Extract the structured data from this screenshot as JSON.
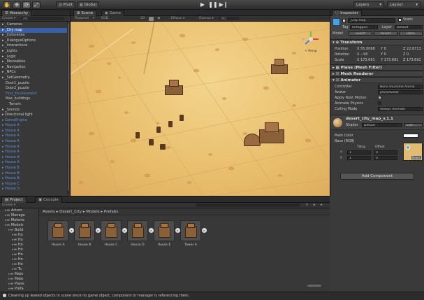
{
  "toolbar": {
    "pivot": "Pivot",
    "global": "Global",
    "layers": "Layers",
    "layout": "Layout"
  },
  "hierarchy": {
    "tab": "Hierarchy",
    "create": "Create ▾",
    "search": "(All",
    "items": [
      {
        "label": "_Cameras",
        "color": "white"
      },
      {
        "label": "_City map",
        "color": "white",
        "selected": true
      },
      {
        "label": "_Cutscenes",
        "color": "white"
      },
      {
        "label": "_DialogueOptions",
        "color": "white"
      },
      {
        "label": "_Interactions",
        "color": "white"
      },
      {
        "label": "_Lights",
        "color": "white"
      },
      {
        "label": "_Logic",
        "color": "white"
      },
      {
        "label": "_Moveables",
        "color": "white"
      },
      {
        "label": "_Navigation",
        "color": "white"
      },
      {
        "label": "_NPCs",
        "color": "white"
      },
      {
        "label": "_SetGeometry",
        "color": "white"
      },
      {
        "label": "Door1_puzzle",
        "color": "white",
        "indent": 1
      },
      {
        "label": "Door2_puzzle",
        "color": "white",
        "indent": 1
      },
      {
        "label": "First_Environment",
        "color": "blue",
        "indent": 1
      },
      {
        "label": "Mas_buildings",
        "color": "white",
        "indent": 1
      },
      {
        "label": "Terrain",
        "color": "white",
        "indent": 2
      },
      {
        "label": "_Sounds",
        "color": "white"
      },
      {
        "label": "Directional light",
        "color": "white"
      },
      {
        "label": "GameEngine",
        "color": "blue"
      },
      {
        "label": "House A",
        "color": "blue"
      },
      {
        "label": "House A",
        "color": "blue"
      },
      {
        "label": "House A",
        "color": "blue"
      },
      {
        "label": "House A",
        "color": "blue"
      },
      {
        "label": "House A",
        "color": "blue"
      },
      {
        "label": "House A",
        "color": "blue"
      },
      {
        "label": "House A",
        "color": "blue"
      },
      {
        "label": "House A",
        "color": "blue"
      },
      {
        "label": "House B",
        "color": "blue"
      },
      {
        "label": "House B",
        "color": "blue"
      },
      {
        "label": "House B",
        "color": "blue"
      },
      {
        "label": "House C",
        "color": "blue"
      },
      {
        "label": "House D",
        "color": "blue"
      }
    ]
  },
  "scene": {
    "tab_scene": "Scene",
    "tab_game": "Game",
    "shading": "Textured",
    "render": "RGB",
    "mode": "2D",
    "effects": "Effects ▾",
    "gizmos": "Gizmos ▾",
    "search": "(All)",
    "persp": "< Persp"
  },
  "inspector": {
    "tab": "Inspector",
    "name": "_City map",
    "static": "Static",
    "tag_label": "Tag",
    "tag": "Untagged",
    "layer_label": "Layer",
    "layer": "Default",
    "model_label": "Model",
    "model_select": "Select",
    "model_revert": "Revert",
    "model_open": "Open",
    "transform": {
      "title": "Transform",
      "position_label": "Position",
      "rotation_label": "Rotation",
      "scale_label": "Scale",
      "position": [
        "X 55.0068",
        "Y 0",
        "Z 22.8713"
      ],
      "rotation": [
        "X −90",
        "Y 0",
        "Z 0"
      ],
      "scale": [
        "X 173.691",
        "Y 173.691",
        "Z 173.691"
      ]
    },
    "mesh_filter": {
      "title": "Plane (Mesh Filter)"
    },
    "mesh_renderer": {
      "title": "Mesh Renderer"
    },
    "animator": {
      "title": "Animator",
      "controller_label": "Controller",
      "controller": "None (Runtime Anima",
      "avatar_label": "Avatar",
      "avatar": "planeAvatar",
      "root_motion_label": "Apply Root Motion",
      "physics_label": "Animate Physics",
      "culling_label": "Culling Mode",
      "culling": "Always Animate"
    },
    "material": {
      "title": "desert_city_map_v.1.1",
      "shader_label": "Shader",
      "shader": "Diffuse",
      "edit": "Edit...",
      "main_color_label": "Main Color",
      "base_label": "Base (RGB)",
      "tiling": "Tiling",
      "offset": "Offset",
      "x_tiling": "1",
      "x_offset": "0",
      "y_tiling": "1",
      "y_offset": "0",
      "select": "Select"
    },
    "add_component": "Add Component"
  },
  "project": {
    "tab_project": "Project",
    "tab_console": "Console",
    "create": "Create ▾",
    "tree": [
      {
        "label": "Actors",
        "indent": 1
      },
      {
        "label": "Manage",
        "indent": 1
      },
      {
        "label": "Materia",
        "indent": 1
      },
      {
        "label": "Models",
        "indent": 1
      },
      {
        "label": "Build",
        "indent": 2
      },
      {
        "label": "Ho",
        "indent": 3
      },
      {
        "label": "Ho",
        "indent": 3
      },
      {
        "label": "Ho",
        "indent": 3
      },
      {
        "label": "Ho",
        "indent": 3
      },
      {
        "label": "Ho",
        "indent": 3
      },
      {
        "label": "Ho",
        "indent": 3
      },
      {
        "label": "Ho",
        "indent": 3
      },
      {
        "label": "To",
        "indent": 3
      },
      {
        "label": "Mate",
        "indent": 2
      },
      {
        "label": "Mate",
        "indent": 2
      },
      {
        "label": "Plane",
        "indent": 2
      },
      {
        "label": "Prefa",
        "indent": 2
      }
    ],
    "breadcrumb": "Assets ▸ Desert_City ▸ Models ▸ Prefabs",
    "assets": [
      "House A",
      "House B",
      "House C",
      "House D",
      "House E",
      "Tower A"
    ]
  },
  "status": {
    "message": "Cleaning up leaked objects in scene since no game object, component or manager is referencing them."
  }
}
